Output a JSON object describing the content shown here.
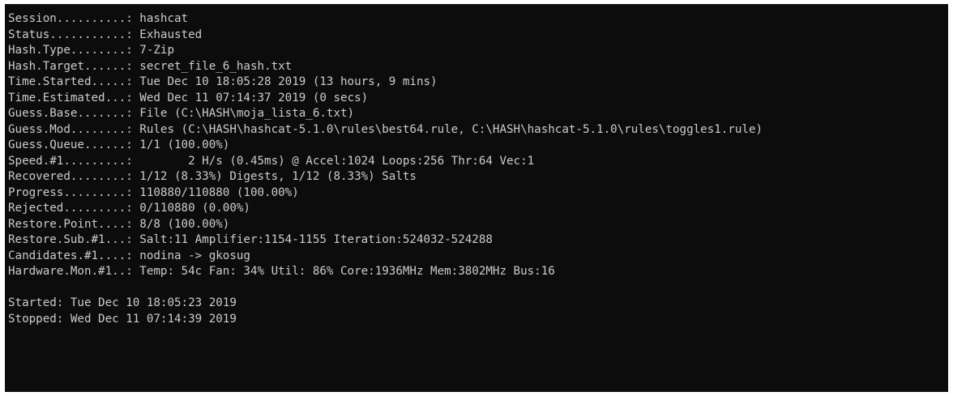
{
  "terminal": {
    "background": "#0c0c0c",
    "foreground": "#cccccc",
    "lines": [
      "Session..........: hashcat",
      "Status...........: Exhausted",
      "Hash.Type........: 7-Zip",
      "Hash.Target......: secret_file_6_hash.txt",
      "Time.Started.....: Tue Dec 10 18:05:28 2019 (13 hours, 9 mins)",
      "Time.Estimated...: Wed Dec 11 07:14:37 2019 (0 secs)",
      "Guess.Base.......: File (C:\\HASH\\moja_lista_6.txt)",
      "Guess.Mod........: Rules (C:\\HASH\\hashcat-5.1.0\\rules\\best64.rule, C:\\HASH\\hashcat-5.1.0\\rules\\toggles1.rule)",
      "Guess.Queue......: 1/1 (100.00%)",
      "Speed.#1.........:        2 H/s (0.45ms) @ Accel:1024 Loops:256 Thr:64 Vec:1",
      "Recovered........: 1/12 (8.33%) Digests, 1/12 (8.33%) Salts",
      "Progress.........: 110880/110880 (100.00%)",
      "Rejected.........: 0/110880 (0.00%)",
      "Restore.Point....: 8/8 (100.00%)",
      "Restore.Sub.#1...: Salt:11 Amplifier:1154-1155 Iteration:524032-524288",
      "Candidates.#1....: nodina -> gkosug",
      "Hardware.Mon.#1..: Temp: 54c Fan: 34% Util: 86% Core:1936MHz Mem:3802MHz Bus:16",
      "",
      "Started: Tue Dec 10 18:05:23 2019",
      "Stopped: Wed Dec 11 07:14:39 2019"
    ]
  }
}
